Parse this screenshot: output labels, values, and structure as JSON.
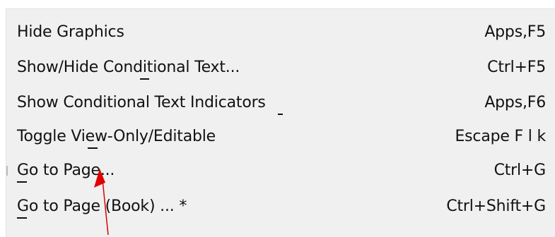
{
  "menu": {
    "items": [
      {
        "label": "Hide Graphics",
        "shortcut": "Apps,F5"
      },
      {
        "label": "Show/Hide Conditional Text...",
        "shortcut": "Ctrl+F5"
      },
      {
        "label": "Show Conditional Text Indicators",
        "shortcut": "Apps,F6"
      },
      {
        "label": "Toggle View-Only/Editable",
        "shortcut": "Escape F l k"
      },
      {
        "label": "Go to Page...",
        "shortcut": "Ctrl+G"
      },
      {
        "label": "Go to Page (Book) ... *",
        "shortcut": "Ctrl+Shift+G"
      }
    ]
  },
  "annotation": {
    "arrow_color": "#e00000",
    "icon": "red-arrow-pointer"
  },
  "colors": {
    "menu_background": "#f0f0f0",
    "text": "#111111"
  }
}
